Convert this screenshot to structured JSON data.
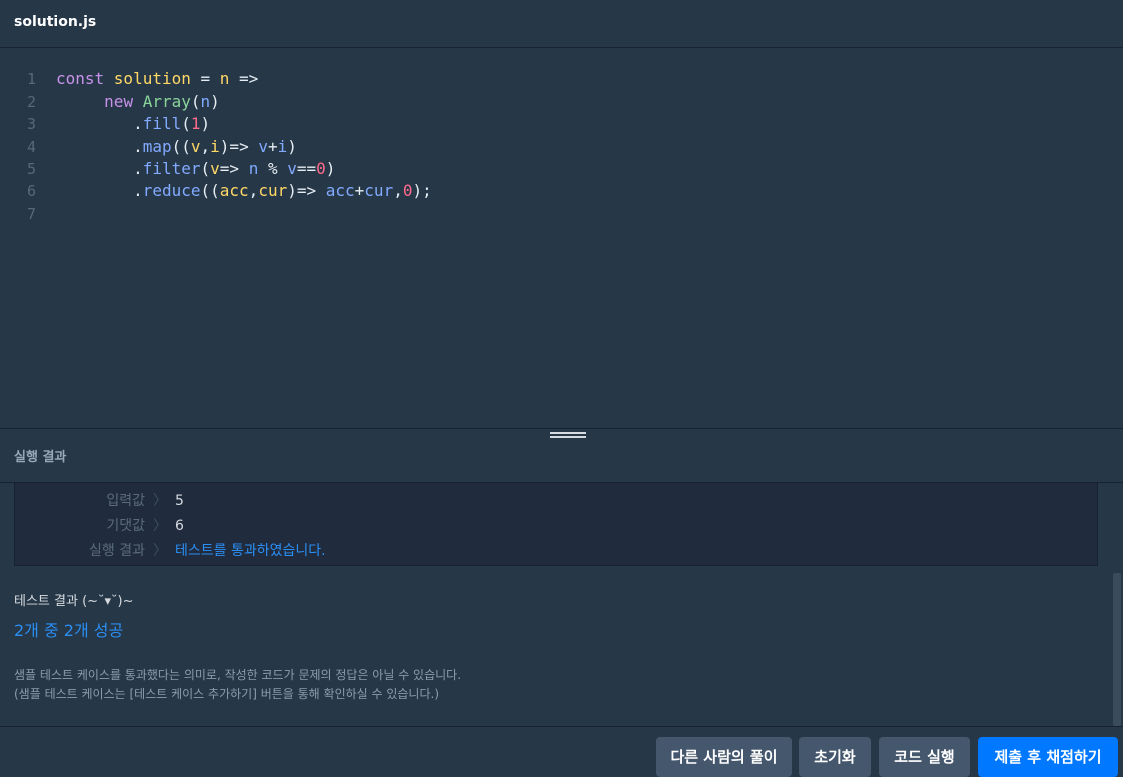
{
  "header": {
    "file_name": "solution.js"
  },
  "editor": {
    "line_numbers": [
      "1",
      "2",
      "3",
      "4",
      "5",
      "6",
      "7"
    ],
    "lines": [
      [
        {
          "t": "const ",
          "c": "kw"
        },
        {
          "t": "solution",
          "c": "fn"
        },
        {
          "t": " = ",
          "c": "op"
        },
        {
          "t": "n",
          "c": "fn"
        },
        {
          "t": " =>",
          "c": "op"
        }
      ],
      [
        {
          "t": "     "
        },
        {
          "t": "new ",
          "c": "kw"
        },
        {
          "t": "Array",
          "c": "cls"
        },
        {
          "t": "(",
          "c": "op"
        },
        {
          "t": "n",
          "c": "pl"
        },
        {
          "t": ")",
          "c": "op"
        }
      ],
      [
        {
          "t": "        ."
        },
        {
          "t": "fill",
          "c": "mth"
        },
        {
          "t": "(",
          "c": "op"
        },
        {
          "t": "1",
          "c": "num"
        },
        {
          "t": ")",
          "c": "op"
        }
      ],
      [
        {
          "t": "        ."
        },
        {
          "t": "map",
          "c": "mth"
        },
        {
          "t": "((",
          "c": "op"
        },
        {
          "t": "v",
          "c": "par"
        },
        {
          "t": ",",
          "c": "op"
        },
        {
          "t": "i",
          "c": "par"
        },
        {
          "t": ")=> ",
          "c": "op"
        },
        {
          "t": "v",
          "c": "pl"
        },
        {
          "t": "+",
          "c": "op"
        },
        {
          "t": "i",
          "c": "pl"
        },
        {
          "t": ")",
          "c": "op"
        }
      ],
      [
        {
          "t": "        ."
        },
        {
          "t": "filter",
          "c": "mth"
        },
        {
          "t": "(",
          "c": "op"
        },
        {
          "t": "v",
          "c": "par"
        },
        {
          "t": "=> ",
          "c": "op"
        },
        {
          "t": "n",
          "c": "pl"
        },
        {
          "t": " % ",
          "c": "op"
        },
        {
          "t": "v",
          "c": "pl"
        },
        {
          "t": "==",
          "c": "op"
        },
        {
          "t": "0",
          "c": "num"
        },
        {
          "t": ")",
          "c": "op"
        }
      ],
      [
        {
          "t": "        ."
        },
        {
          "t": "reduce",
          "c": "mth"
        },
        {
          "t": "((",
          "c": "op"
        },
        {
          "t": "acc",
          "c": "par"
        },
        {
          "t": ",",
          "c": "op"
        },
        {
          "t": "cur",
          "c": "par"
        },
        {
          "t": ")=> ",
          "c": "op"
        },
        {
          "t": "acc",
          "c": "pl"
        },
        {
          "t": "+",
          "c": "op"
        },
        {
          "t": "cur",
          "c": "pl"
        },
        {
          "t": ",",
          "c": "op"
        },
        {
          "t": "0",
          "c": "num"
        },
        {
          "t": ");",
          "c": "op"
        }
      ],
      []
    ]
  },
  "result": {
    "title": "실행 결과",
    "rows": [
      {
        "label": "입력값",
        "sep": "〉",
        "value": "5",
        "status": "normal"
      },
      {
        "label": "기댓값",
        "sep": "〉",
        "value": "6",
        "status": "normal"
      },
      {
        "label": "실행 결과",
        "sep": "〉",
        "value": "테스트를 통과하였습니다.",
        "status": "pass"
      }
    ]
  },
  "test": {
    "title": "테스트 결과 (~˘▾˘)~",
    "count": "2개 중 2개 성공",
    "note1": "샘플 테스트 케이스를 통과했다는 의미로, 작성한 코드가 문제의 정답은 아닐 수 있습니다.",
    "note2": "(샘플 테스트 케이스는 [테스트 케이스 추가하기] 버튼을 통해 확인하실 수 있습니다.)"
  },
  "footer": {
    "others_label": "다른 사람의 풀이",
    "reset_label": "초기화",
    "run_label": "코드 실행",
    "submit_label": "제출 후 채점하기"
  },
  "colors": {
    "accent": "#0078ff",
    "pass": "#2b8ef3",
    "background": "#263747"
  }
}
